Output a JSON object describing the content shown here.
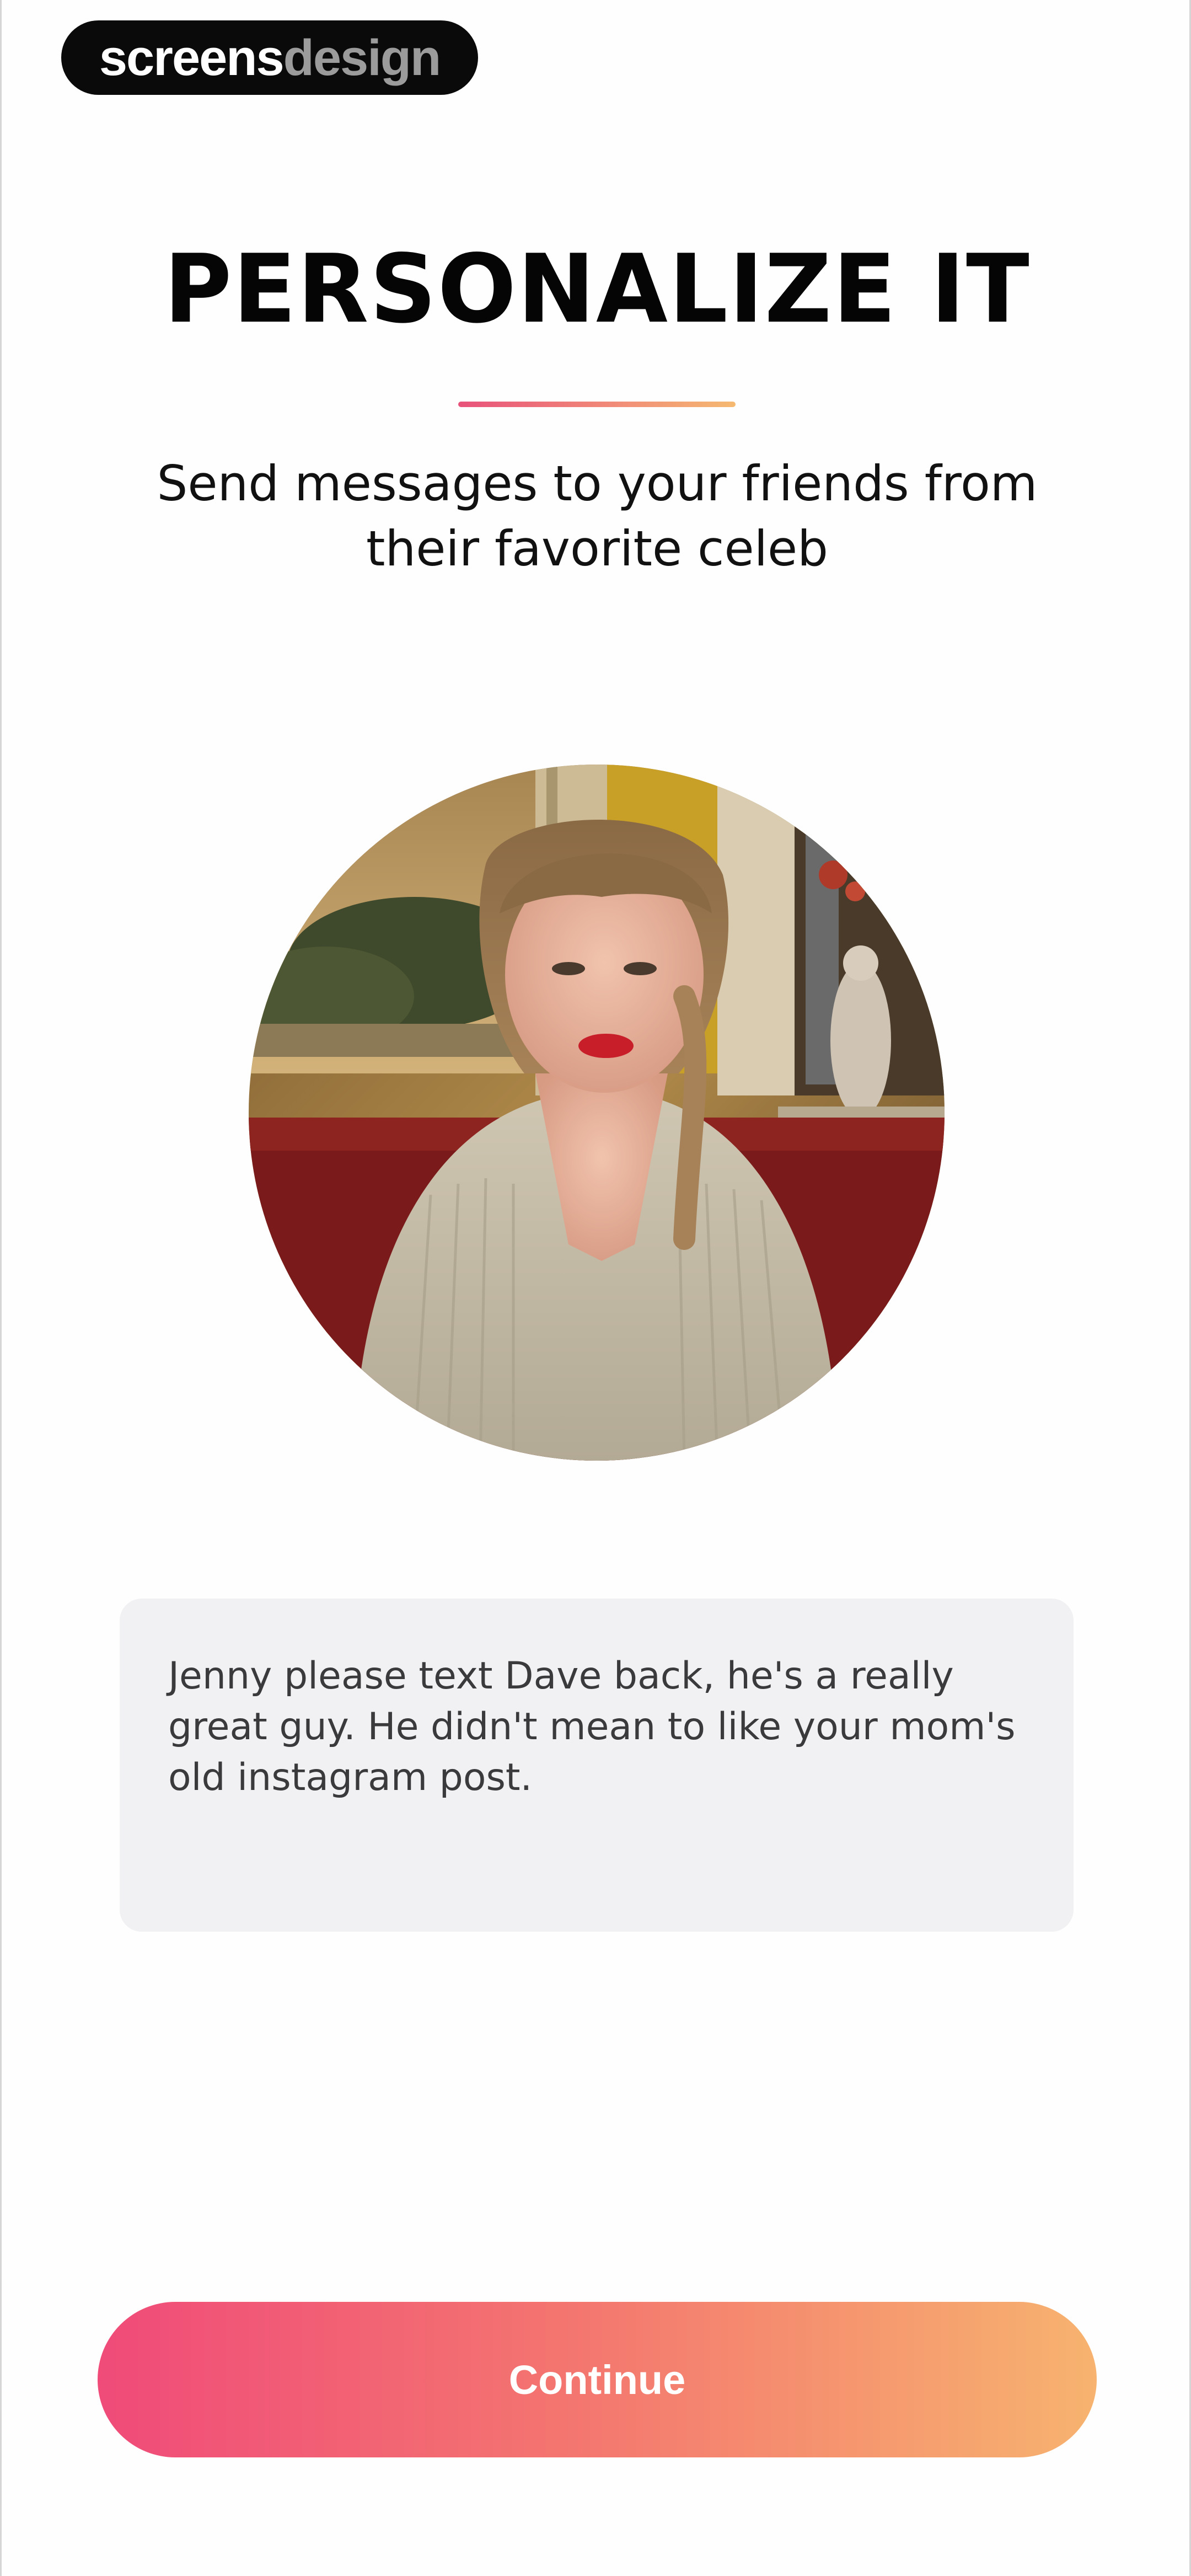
{
  "brand": {
    "part1": "screens",
    "part2": "design"
  },
  "header": {
    "title": "PERSONALIZE IT",
    "subtitle": "Send messages to your friends from their favorite celeb"
  },
  "celebrity": {
    "image": "celebrity-video-portrait"
  },
  "message": {
    "text": "Jenny please text Dave back, he's a really great guy. He didn't mean to like your mom's old instagram post."
  },
  "actions": {
    "continue_label": "Continue"
  },
  "colors": {
    "gradient_start": "#f04b79",
    "gradient_end": "#f7b36f",
    "message_bg": "#f1f1f3"
  }
}
